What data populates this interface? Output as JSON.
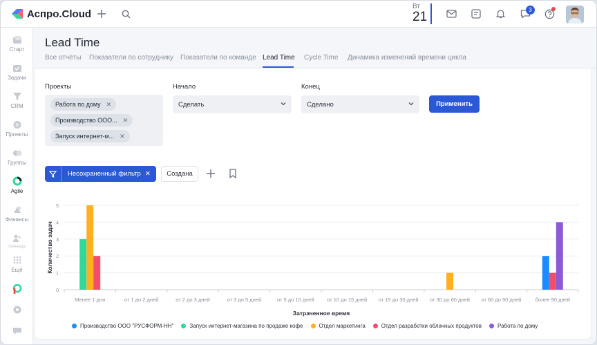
{
  "brand": {
    "name": "Аспро.Cloud"
  },
  "topbar": {
    "day_abbr": "Вт",
    "day_num": "21",
    "messages_badge": "3"
  },
  "sidebar": {
    "items": [
      {
        "label": "Старт",
        "icon": "home-icon"
      },
      {
        "label": "Задачи",
        "icon": "tasks-icon"
      },
      {
        "label": "CRM",
        "icon": "crm-icon"
      },
      {
        "label": "Проекты",
        "icon": "projects-icon"
      },
      {
        "label": "Группы",
        "icon": "groups-icon"
      },
      {
        "label": "Agile",
        "icon": "agile-icon"
      },
      {
        "label": "Финансы",
        "icon": "finance-icon"
      },
      {
        "label": "Команда",
        "icon": "team-icon"
      },
      {
        "label": "Ещё",
        "icon": "more-icon"
      }
    ]
  },
  "page": {
    "title": "Lead Time",
    "tabs": [
      {
        "label": "Все отчёты"
      },
      {
        "label": "Показатели по сотруднику"
      },
      {
        "label": "Показатели по команде"
      },
      {
        "label": "Lead Time"
      },
      {
        "label": "Cycle Time"
      },
      {
        "label": "Динамика изменений времени цикла"
      }
    ],
    "active_tab": "Lead Time"
  },
  "filters": {
    "projects_label": "Проекты",
    "projects": [
      "Работа по дому",
      "Производство ООО...",
      "Запуск интернет-м..."
    ],
    "start_label": "Начало",
    "start_value": "Сделать",
    "end_label": "Конец",
    "end_value": "Сделано",
    "apply_label": "Применить"
  },
  "toolbar": {
    "filter_label": "Несохраненный фильтр",
    "created_label": "Создана"
  },
  "colors": {
    "accent": "#2b59d6",
    "series": [
      "#1a8cff",
      "#2ed99a",
      "#ffb020",
      "#f24d6b",
      "#8b5cd6"
    ]
  },
  "chart_data": {
    "type": "bar",
    "xlabel": "Затраченное время",
    "ylabel": "Количество задач",
    "ylim": [
      0,
      5
    ],
    "yticks": [
      0,
      1,
      2,
      3,
      4,
      5
    ],
    "categories": [
      "Менее 1 дня",
      "от 1 до 2 дней",
      "от 2 до 3 дней",
      "от 3 до 5 дней",
      "от 5 до 10 дней",
      "от 10 до 15 дней",
      "от 15 до 30 дней",
      "от 30 до 60 дней",
      "от 60 до 90 дней",
      "более 90 дней"
    ],
    "series": [
      {
        "name": "Производство ООО \"РУСФОРМ-НН\"",
        "color": "#1a8cff",
        "values": [
          0,
          0,
          0,
          0,
          0,
          0,
          0,
          0,
          0,
          2
        ]
      },
      {
        "name": "Запуск интернет-магазина по продаже кофе",
        "color": "#2ed99a",
        "values": [
          3,
          0,
          0,
          0,
          0,
          0,
          0,
          0,
          0,
          0
        ]
      },
      {
        "name": "Отдел маркетинга",
        "color": "#ffb020",
        "values": [
          5,
          0,
          0,
          0,
          0,
          0,
          0,
          1,
          0,
          0
        ]
      },
      {
        "name": "Отдел разработки облачных продуктов",
        "color": "#f24d6b",
        "values": [
          2,
          0,
          0,
          0,
          0,
          0,
          0,
          0,
          0,
          1
        ]
      },
      {
        "name": "Работа по дому",
        "color": "#8b5cd6",
        "values": [
          0,
          0,
          0,
          0,
          0,
          0,
          0,
          0,
          0,
          4
        ]
      }
    ],
    "legend_position": "bottom",
    "grid": true
  }
}
